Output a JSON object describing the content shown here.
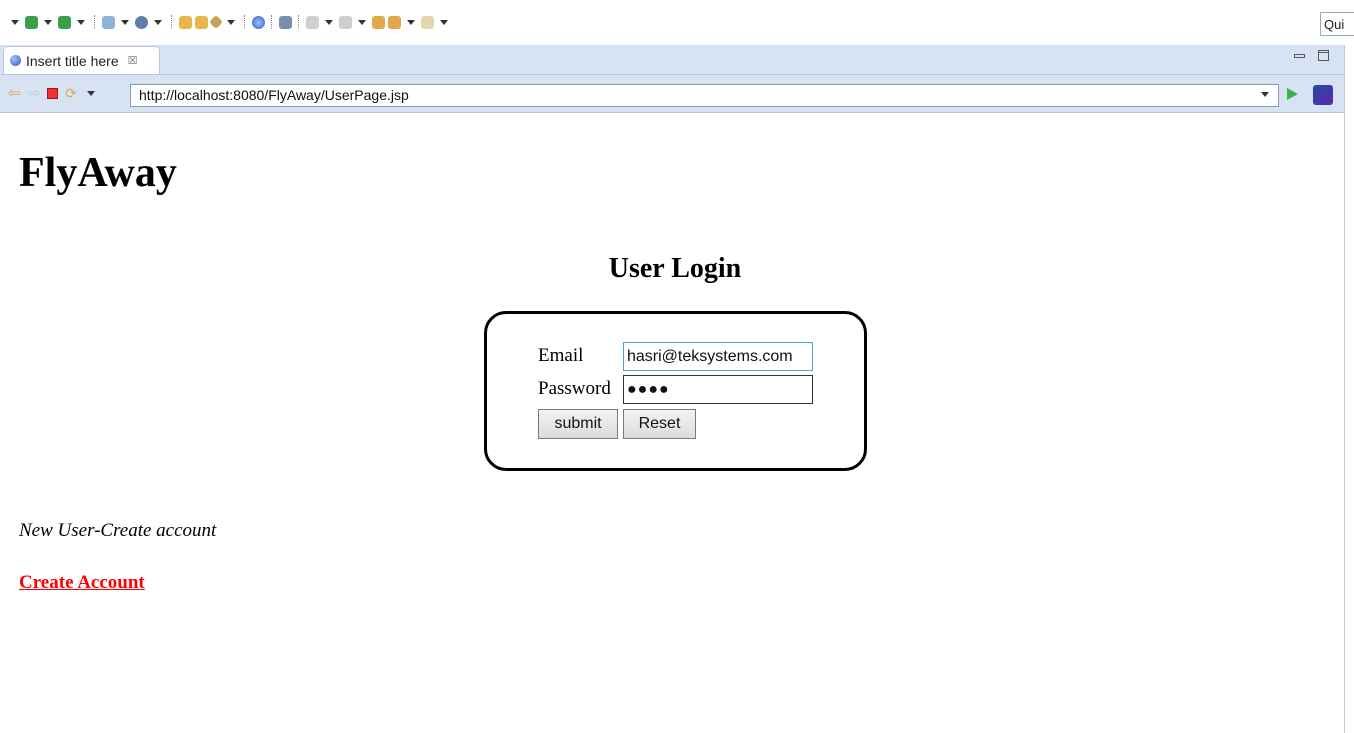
{
  "toolbar": {
    "quick_access_text": "Qui",
    "icons": [
      "debug-icon",
      "run-icon",
      "external-tools-icon",
      "new-server-icon",
      "open-type-icon",
      "open-resource-icon",
      "pin-icon",
      "browser-icon",
      "search-icon",
      "next-annotation-icon",
      "prev-annotation-icon",
      "back-icon",
      "forward-icon"
    ]
  },
  "tab": {
    "title": "Insert title here",
    "close_glyph": "☒"
  },
  "browser": {
    "url": "http://localhost:8080/FlyAway/UserPage.jsp"
  },
  "page": {
    "site_title": "FlyAway",
    "login_heading": "User Login",
    "email_label": "Email",
    "email_value": "hasri@teksystems.com",
    "password_label": "Password",
    "password_value": "●●●●",
    "submit_label": "submit",
    "reset_label": "Reset",
    "new_user_text": "New User-Create account",
    "create_account_label": "Create Account"
  },
  "colors": {
    "link": "#ff0000",
    "tab_strip": "#d7e3f2",
    "focus_border": "#4aa3df"
  }
}
